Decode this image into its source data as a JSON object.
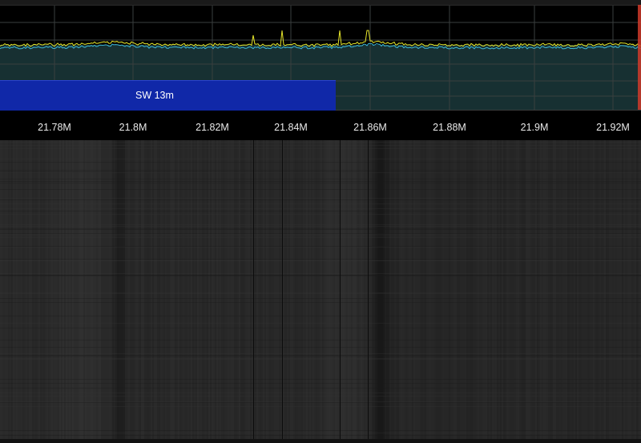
{
  "fft": {
    "frequency_ticks": [
      "21.78M",
      "21.8M",
      "21.82M",
      "21.84M",
      "21.86M",
      "21.88M",
      "21.9M",
      "21.92M"
    ],
    "trace_colors": {
      "peak_hold": "#e6e62a",
      "live": "#3cb8d8"
    },
    "fill_color": "#173032",
    "band_plan": {
      "label": "SW 13m",
      "color": "#1028a8"
    },
    "tuned_marker_color": "#d03a2a"
  },
  "waterfall": {
    "background": "#262626"
  }
}
